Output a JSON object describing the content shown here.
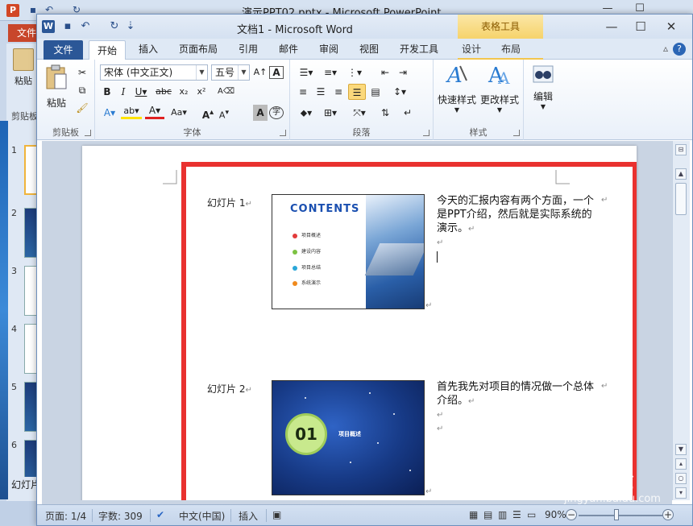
{
  "ppt": {
    "title": "演示PPT02.pptx  -  Microsoft PowerPoint",
    "file_tab": "文件",
    "paste_label": "粘贴",
    "clipboard_label": "剪贴板",
    "slides_tab": "幻灯片",
    "thumbs": [
      {
        "n": "1",
        "light": true,
        "sel": true
      },
      {
        "n": "2",
        "light": false,
        "sel": false
      },
      {
        "n": "3",
        "light": true,
        "sel": false
      },
      {
        "n": "4",
        "light": true,
        "sel": false
      },
      {
        "n": "5",
        "light": false,
        "sel": false
      },
      {
        "n": "6",
        "light": false,
        "sel": false
      }
    ]
  },
  "word": {
    "title": "文档1  -  Microsoft Word",
    "context_tools": "表格工具",
    "tabs": {
      "file": "文件",
      "home": "开始",
      "insert": "插入",
      "layout": "页面布局",
      "references": "引用",
      "mailings": "邮件",
      "review": "审阅",
      "view": "视图",
      "developer": "开发工具",
      "design": "设计",
      "table_layout": "布局"
    },
    "ribbon": {
      "paste": "粘贴",
      "clipboard": "剪贴板",
      "font_name": "宋体 (中文正文)",
      "font_size": "五号",
      "font_group": "字体",
      "paragraph_group": "段落",
      "quick_styles": "快速样式",
      "change_styles": "更改样式",
      "styles_group": "样式",
      "editing": "编辑"
    },
    "doc": {
      "slide1_label": "幻灯片 1",
      "slide1_notes": "今天的汇报内容有两个方面，一个是PPT介绍，然后就是实际系统的演示。",
      "slide1_title": "CONTENTS",
      "slide1_items": [
        "项目概述",
        "建设内容",
        "项目总结",
        "系统演示"
      ],
      "slide1_dot_colors": [
        "#e23b3b",
        "#7cc242",
        "#2aa7d8",
        "#f08a1c"
      ],
      "slide2_label": "幻灯片 2",
      "slide2_notes": "首先我先对项目的情况做一个总体介绍。",
      "slide2_number": "01",
      "slide2_title": "项目概述",
      "para_mark": "↵"
    },
    "status": {
      "page": "页面: 1/4",
      "words": "字数: 309",
      "language": "中文(中国)",
      "mode": "插入",
      "zoom": "90%"
    }
  },
  "watermark": {
    "brand": "Bai",
    "brand2": "经验",
    "url": "jingyan.baidu.com"
  },
  "colors": {
    "highlight_frame": "#e9312f",
    "word_blue": "#2b5797",
    "table_tools": "#f6d36b"
  }
}
